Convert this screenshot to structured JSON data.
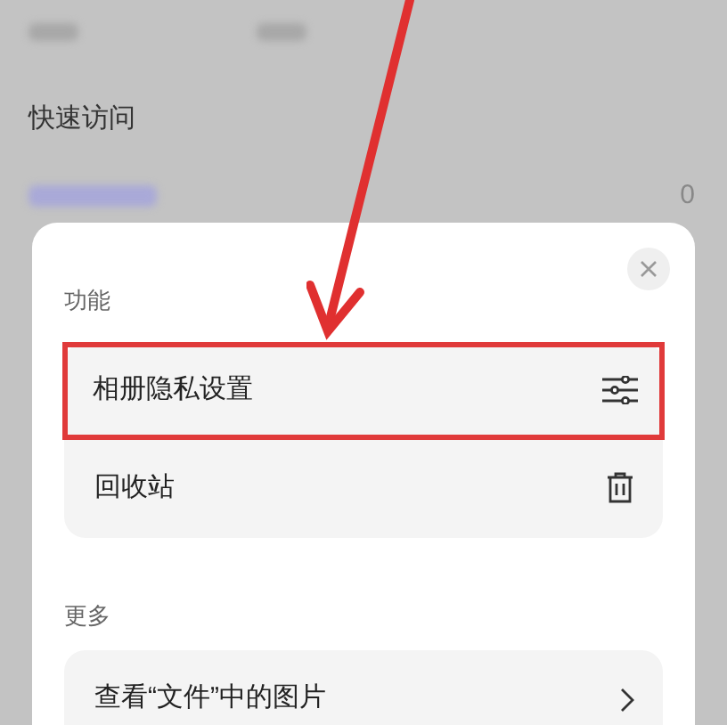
{
  "background": {
    "section_title": "快速访问",
    "count": "0"
  },
  "sheet": {
    "sections": [
      {
        "title": "功能",
        "items": [
          {
            "label": "相册隐私设置",
            "kind": "settings",
            "highlighted": true
          },
          {
            "label": "回收站",
            "kind": "trash",
            "highlighted": false
          }
        ]
      },
      {
        "title": "更多",
        "items": [
          {
            "label": "查看“文件”中的图片",
            "kind": "link",
            "highlighted": false
          }
        ]
      }
    ]
  }
}
